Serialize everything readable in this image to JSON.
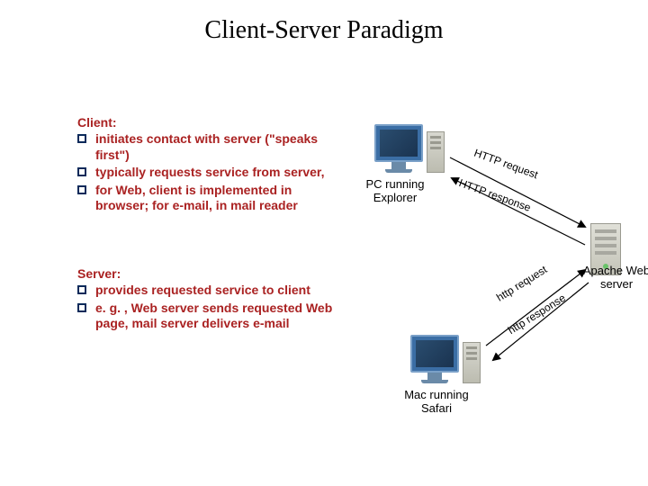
{
  "title": "Client-Server Paradigm",
  "client": {
    "heading": "Client:",
    "items": [
      "initiates contact with server (\"speaks first\")",
      "typically requests service from server,",
      "for Web, client is implemented in browser; for e-mail, in mail reader"
    ]
  },
  "server": {
    "heading": "Server:",
    "items": [
      "provides requested service to client",
      "e. g. , Web server sends requested Web page, mail server delivers e-mail"
    ]
  },
  "labels": {
    "pc": "PC running Explorer",
    "mac": "Mac running Safari",
    "srv": "Apache Web server"
  },
  "messages": {
    "req1": "HTTP request",
    "res1": "HTTP response",
    "req2": "http request",
    "res2": "http response"
  }
}
